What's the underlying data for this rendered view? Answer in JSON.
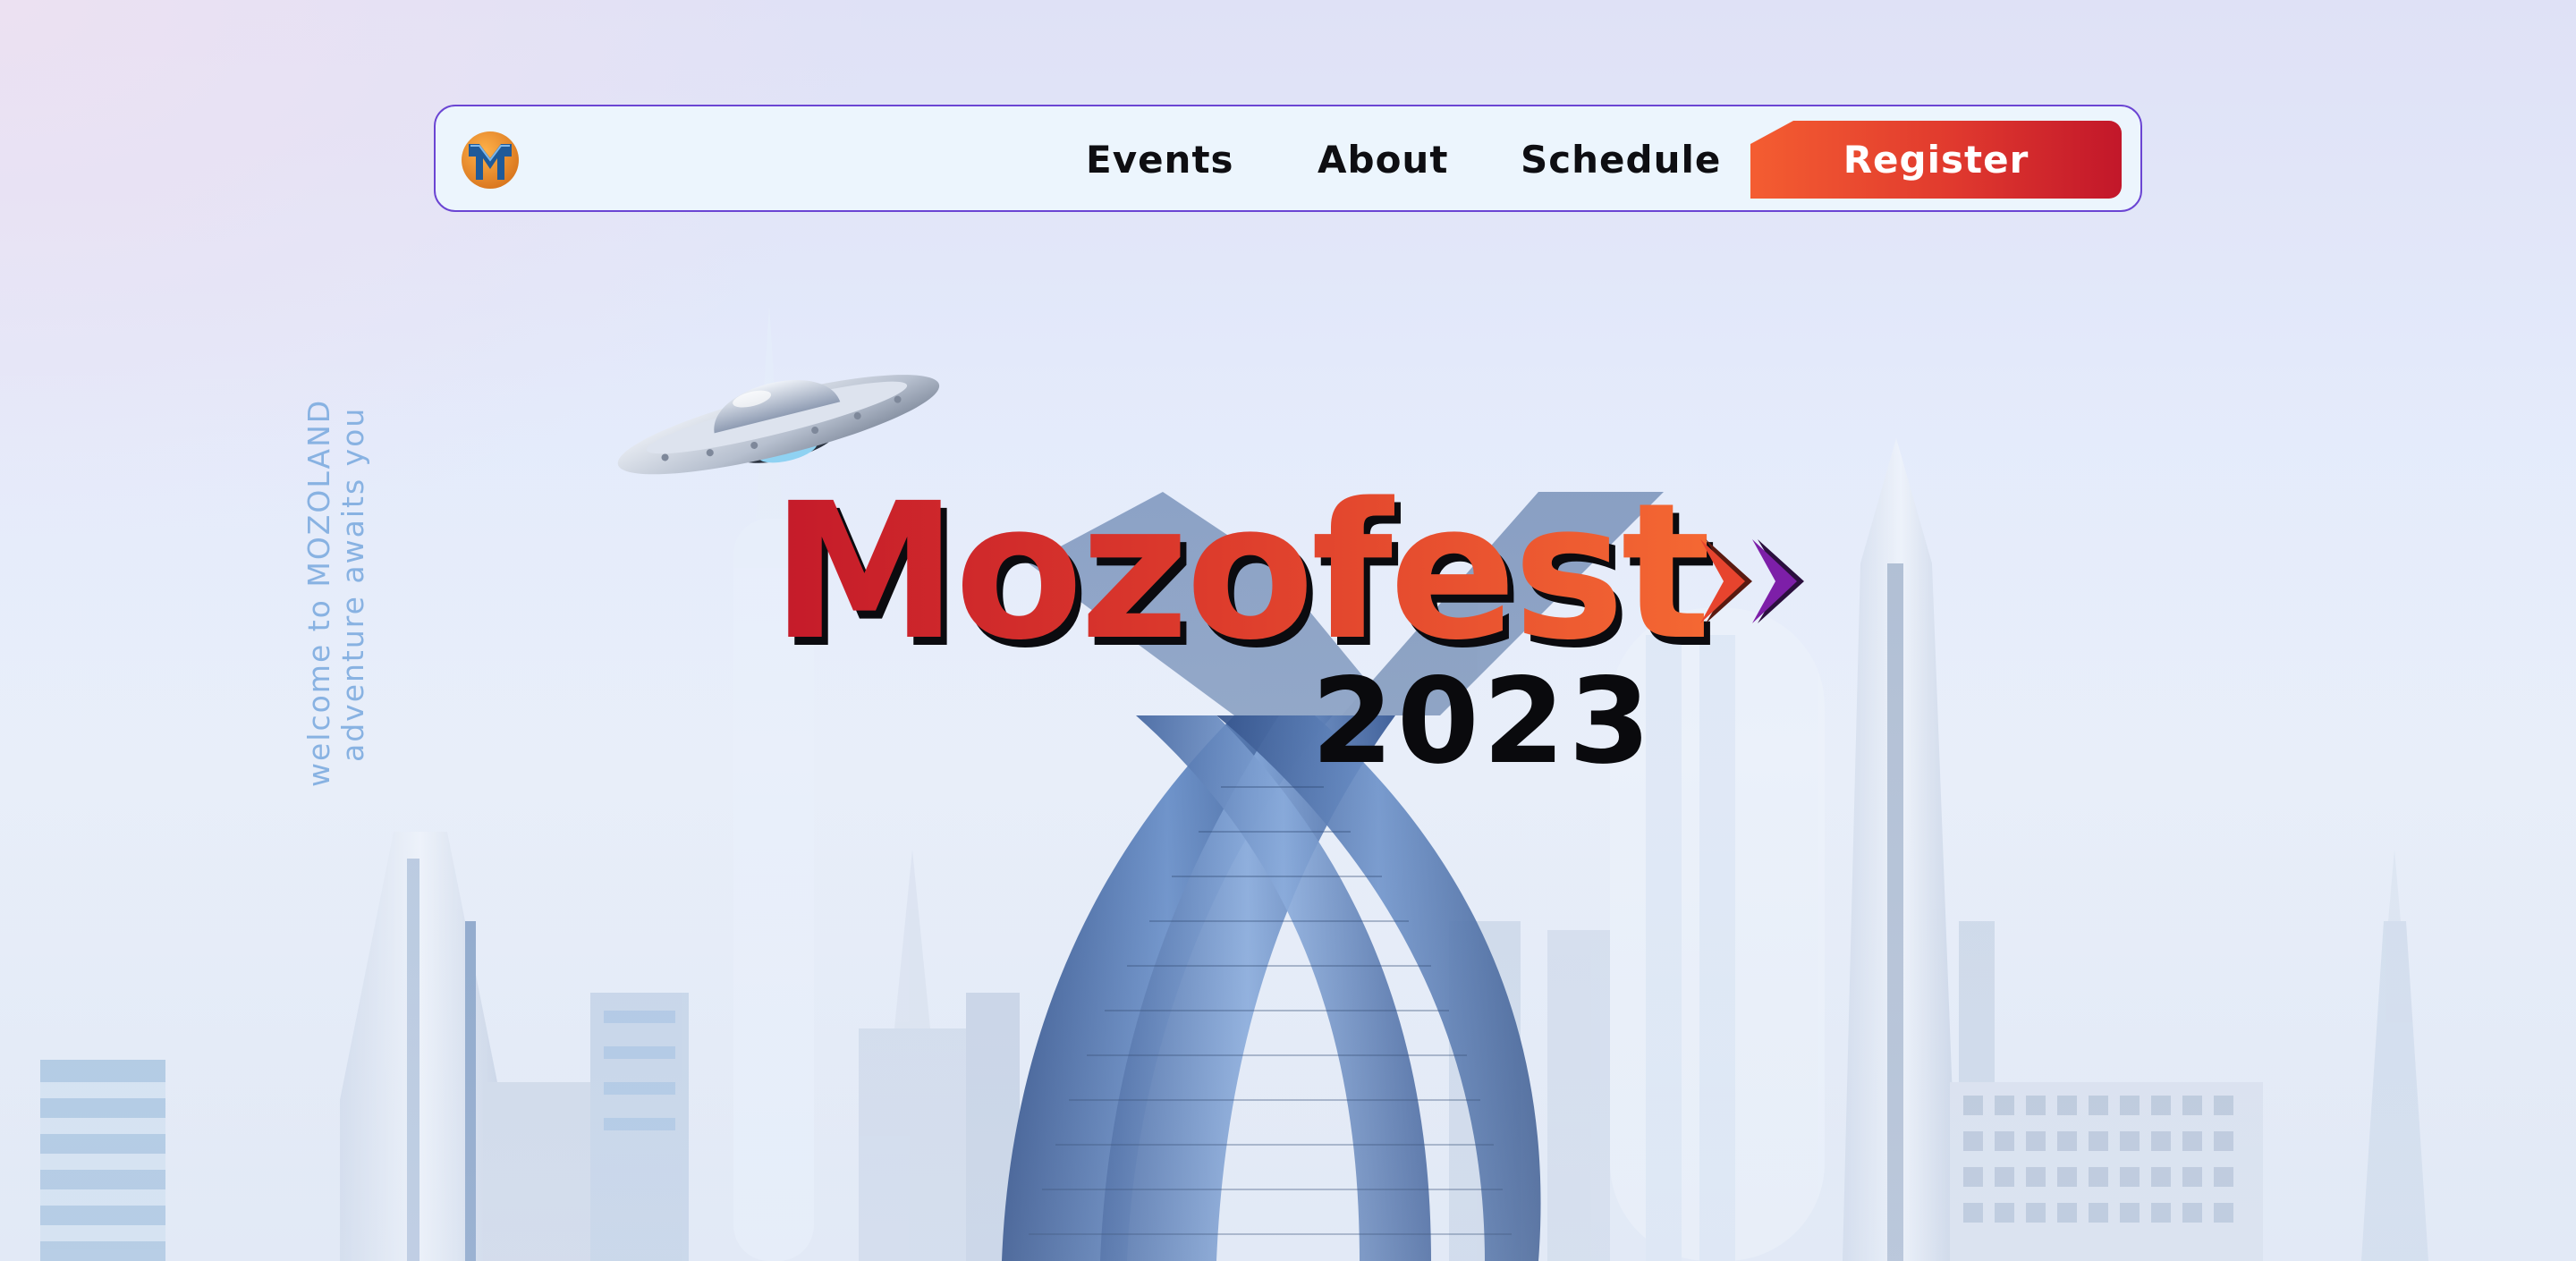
{
  "nav": {
    "links": [
      {
        "label": "Events"
      },
      {
        "label": "About"
      },
      {
        "label": "Schedule"
      }
    ],
    "register_label": "Register",
    "logo_icon": "mozofest-m-logo-icon"
  },
  "tagline": {
    "line1": "welcome to MOZOLAND",
    "line2": "adventure awaits you"
  },
  "hero": {
    "title": "Mozofest",
    "year": "2023",
    "chevrons_icon": "double-chevron-right-icon"
  },
  "colors": {
    "accent_red": "#c41a2a",
    "accent_orange": "#f45d31",
    "nav_border": "#6b45d3",
    "tagline": "#88b2e2",
    "chevron_purple": "#7d1fa8"
  }
}
